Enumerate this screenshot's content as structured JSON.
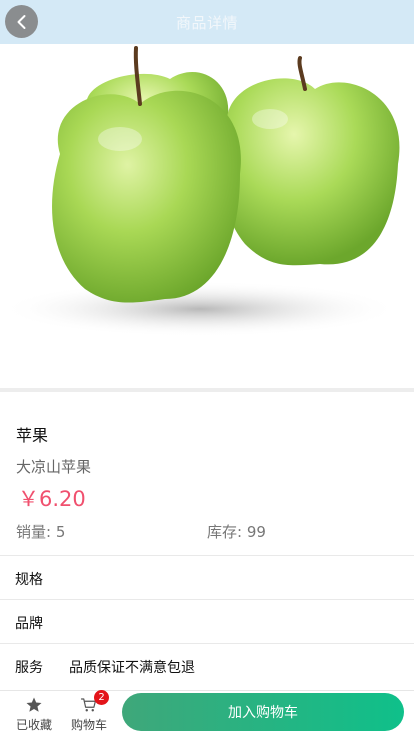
{
  "header": {
    "title": "商品详情",
    "back_icon": "chevron-left-icon"
  },
  "product": {
    "name": "苹果",
    "subtitle": "大凉山苹果",
    "price": "￥6.20",
    "sales": "销量: 5",
    "stock": "库存: 99"
  },
  "attributes": {
    "spec_label": "规格",
    "brand_label": "品牌",
    "service_label": "服务",
    "service_value": "品质保证不满意包退"
  },
  "bottom_bar": {
    "favorite_label": "已收藏",
    "favorite_icon": "star-icon",
    "cart_label": "购物车",
    "cart_icon": "cart-icon",
    "cart_count": "2",
    "add_to_cart_label": "加入购物车"
  },
  "colors": {
    "header_bg": "#d4e9f6",
    "price": "#f0506e",
    "button_start": "#3fa77a",
    "button_end": "#0fc08a",
    "badge": "#e3141a"
  }
}
